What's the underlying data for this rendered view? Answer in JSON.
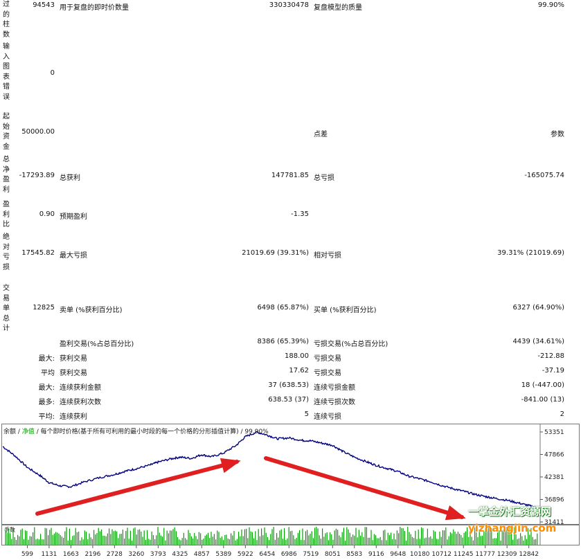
{
  "left_labels": [
    {
      "text": "过的柱数"
    },
    {
      "text": "输入图表错误"
    },
    {
      "text": "起始资金"
    },
    {
      "text": "总净盈利"
    },
    {
      "text": "盈利比"
    },
    {
      "text": "绝对亏损"
    },
    {
      "text": "交易单总计"
    }
  ],
  "top_row": {
    "value": "94543",
    "label": "用于复盘的即时价数量",
    "label_value": "330330478",
    "right_label": "复盘模型的质量",
    "right_value": "99.90%"
  },
  "left_values": [
    "0",
    "50000.00",
    "-17293.89",
    "0.90",
    "17545.82",
    "12825"
  ],
  "rows": [
    {
      "mid_label": "点差",
      "right_value": "参数"
    },
    {
      "mid_label": "总获利",
      "mid_value": "147781.85",
      "right_label": "总亏损",
      "right_value": "-165075.74"
    },
    {
      "mid_label": "预期盈利",
      "mid_value": "-1.35"
    },
    {
      "mid_label": "最大亏损",
      "mid_value": "21019.69 (39.31%)",
      "right_label": "相对亏损",
      "right_value": "39.31% (21019.69)"
    },
    {
      "mid_label": "卖单 (%获利百分比)",
      "mid_value": "6498 (65.87%)",
      "right_label": "买单 (%获利百分比)",
      "right_value": "6327 (64.90%)"
    }
  ],
  "stats": [
    {
      "prefix": "",
      "label": "盈利交易(%占总百分比)",
      "value": "8386 (65.39%)",
      "right_label": "亏损交易(%占总百分比)",
      "right_value": "4439 (34.61%)"
    },
    {
      "prefix": "最大:",
      "label": "获利交易",
      "value": "188.00",
      "right_label": "亏损交易",
      "right_value": "-212.88"
    },
    {
      "prefix": "平均",
      "label": "获利交易",
      "value": "17.62",
      "right_label": "亏损交易",
      "right_value": "-37.19"
    },
    {
      "prefix": "最大:",
      "label": "连续获利金额",
      "value": "37 (638.53)",
      "right_label": "连续亏损金额",
      "right_value": "18 (-447.00)"
    },
    {
      "prefix": "最多:",
      "label": "连续获利次数",
      "value": "638.53 (37)",
      "right_label": "连续亏损次数",
      "right_value": "-841.00 (13)"
    },
    {
      "prefix": "平均:",
      "label": "连续获利",
      "value": "5",
      "right_label": "连续亏损",
      "right_value": "2"
    }
  ],
  "legend": {
    "balance": "余额",
    "equity": "净值",
    "description": "每个即时价格(基于所有可利用的最小时段的每一个价格的分形插值计算)",
    "quality": "99.90%"
  },
  "volume_label": "手数",
  "chart_data": {
    "type": "line",
    "y_ticks": [
      "53351",
      "47866",
      "42381",
      "36896",
      "31411"
    ],
    "x_ticks": [
      "599",
      "1131",
      "1663",
      "2196",
      "2728",
      "3260",
      "3793",
      "4325",
      "4857",
      "5389",
      "5922",
      "6454",
      "6986",
      "7519",
      "8051",
      "8583",
      "9116",
      "9648",
      "10180",
      "10712",
      "11245",
      "11777",
      "12309",
      "12842"
    ],
    "ylim": [
      31411,
      53351
    ],
    "x": [
      0,
      300,
      600,
      900,
      1131,
      1400,
      1663,
      2000,
      2400,
      2728,
      3000,
      3260,
      3600,
      3793,
      4100,
      4325,
      4600,
      4857,
      5100,
      5389,
      5700,
      5922,
      6200,
      6454,
      6700,
      6986,
      7300,
      7519,
      7800,
      8051,
      8300,
      8583,
      8900,
      9116,
      9400,
      9648,
      9900,
      10180,
      10450,
      10712,
      11000,
      11245,
      11500,
      11777,
      12000,
      12309,
      12600,
      12842,
      13050
    ],
    "values": [
      49800,
      47500,
      44700,
      42800,
      41000,
      40200,
      40000,
      41200,
      42300,
      43000,
      43800,
      44400,
      45300,
      46000,
      46800,
      47200,
      46900,
      47800,
      47300,
      48200,
      50100,
      52200,
      53300,
      52600,
      51700,
      51900,
      51300,
      51200,
      50600,
      50100,
      48600,
      47200,
      46000,
      45200,
      44400,
      43700,
      42600,
      41900,
      41200,
      40300,
      39500,
      38900,
      38200,
      37600,
      37200,
      36700,
      36000,
      35400,
      34800
    ],
    "colors": {
      "balance": "#00007f",
      "volume": "#00a000",
      "arrow": "#e02020"
    }
  },
  "watermark": {
    "line1": "一掌金外汇资源网",
    "line2": "yizhangjin.com"
  }
}
